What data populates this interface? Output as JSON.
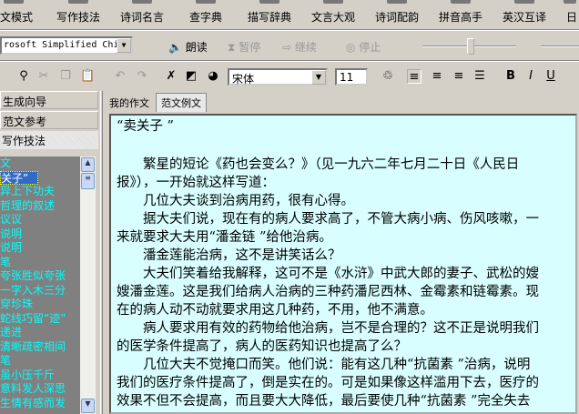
{
  "topbar": [
    "文模式",
    "写作技法",
    "诗词名言",
    "查字典",
    "描写辞典",
    "文言大观",
    "诗词配韵",
    "拼音高手",
    "英汉互译",
    "日"
  ],
  "speech": {
    "voice": "rosoft Simplified Chir",
    "read": "朗读",
    "pause": "暂停",
    "resume": "继续",
    "stop": "停止"
  },
  "format": {
    "font": "宋体",
    "size": "11"
  },
  "left": {
    "buttons": [
      "生成向导",
      "范文参考",
      "写作技法"
    ],
    "items": [
      "文",
      "关子”",
      "异上下功夫",
      "哲理的叙述",
      "议议",
      "说明",
      "说明",
      "笔",
      "夸张胜似夸张",
      "一字入木三分",
      "穿珍珠",
      "蛇线巧留“迹”",
      "递进",
      "清晰疏密相间",
      "笔",
      "虽小压千斤",
      "意料发人深思",
      "生情有感而发"
    ]
  },
  "tabs": [
    "我的作文",
    "范文例文"
  ],
  "doc": {
    "title": "“卖关子 ”",
    "lines": [
      {
        "t": "繁星的短论《药也会变么？》（见一九六二年七月二十日《人民日",
        "p": true
      },
      {
        "t": "报》），一开始就这样写道：",
        "p": false
      },
      {
        "t": "几位大夫谈到治病用药，很有心得。",
        "p": true
      },
      {
        "t": "据大夫们说，现在有的病人要求高了，不管大病小病、伤风咳嗽，一",
        "p": true
      },
      {
        "t": "来就要求大夫用“潘金链 ”给他治病。",
        "p": false
      },
      {
        "t": "潘金莲能治病，这不是讲笑话么？",
        "p": true
      },
      {
        "t": "大夫们笑着给我解释，这可不是《水浒》中武大郎的妻子、武松的嫂",
        "p": true
      },
      {
        "t": "嫂潘金莲。这是我们给病人治病的三种药潘尼西林、金霉素和链霉素。现",
        "p": false
      },
      {
        "t": "在的病人动不动就要求用这几种药，不用，他不满意。",
        "p": false
      },
      {
        "t": "病人要求用有效的药物给他治病，岂不是合理的？这不正是说明我们",
        "p": true
      },
      {
        "t": "的医学条件提高了，病人的医药知识也提高了么？",
        "p": false
      },
      {
        "t": "几位大夫不觉掩口而笑。他们说：能有这几种“抗菌素 ”治病，说明",
        "p": true
      },
      {
        "t": "我们的医疗条件提高了，倒是实在的。可是如果像这样滥用下去，医疗的",
        "p": false
      },
      {
        "t": "效果不但不会提高，而且要大大降低，最后要使几种“抗菌素 ”完全失去",
        "p": false
      }
    ]
  }
}
